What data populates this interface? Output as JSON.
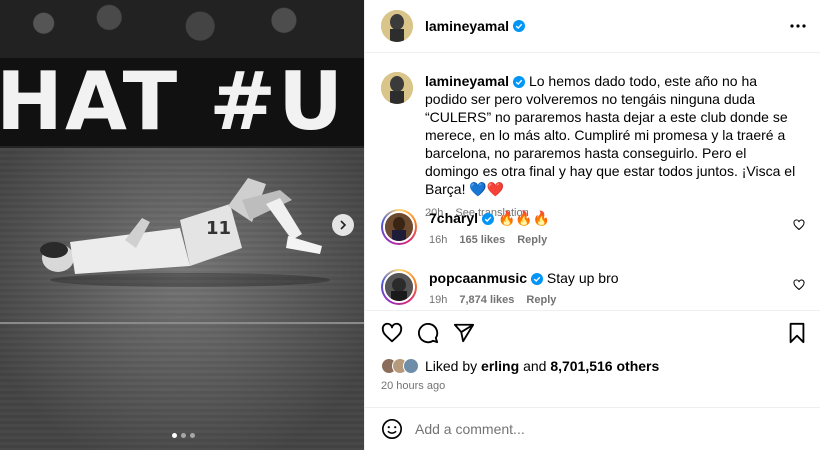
{
  "media": {
    "board_text": "HAT #U",
    "carousel_dots": 3,
    "active_dot": 0,
    "next_icon": "chevron-right-icon"
  },
  "post": {
    "author": "lamineyamal",
    "verified_icon": "verified-badge-icon",
    "more_icon": "more-horizontal-icon"
  },
  "caption": {
    "author": "lamineyamal",
    "text": "Lo hemos dado todo, este año no ha podido ser pero volveremos no tengáis ninguna duda “CULERS” no pararemos hasta dejar a este club donde se merece, en lo más alto. Cumpliré mi promesa y la traeré a barcelona, no pararemos hasta conseguirlo. Pero el domingo es otra final y hay que estar todos juntos. ¡Visca el Barça! 💙❤️",
    "time": "20h",
    "see_translation": "See translation"
  },
  "comments": [
    {
      "author": "7charyl",
      "text": "🔥🔥🔥",
      "time": "16h",
      "likes": "165 likes",
      "reply": "Reply"
    },
    {
      "author": "popcaanmusic",
      "text": "Stay up bro",
      "time": "19h",
      "likes": "7,874 likes",
      "reply": "Reply"
    }
  ],
  "actions": {
    "like_icon": "heart-icon",
    "comment_icon": "comment-icon",
    "share_icon": "share-icon",
    "save_icon": "bookmark-icon"
  },
  "likes": {
    "prefix": "Liked by",
    "user": "erling",
    "conjunction": "and",
    "others": "8,701,516 others"
  },
  "timestamp": "20 hours ago",
  "add_comment": {
    "placeholder": "Add a comment...",
    "emoji_icon": "emoji-icon"
  },
  "colors": {
    "verified": "#0095f6",
    "secondary_text": "#737373",
    "border": "#efefef"
  }
}
